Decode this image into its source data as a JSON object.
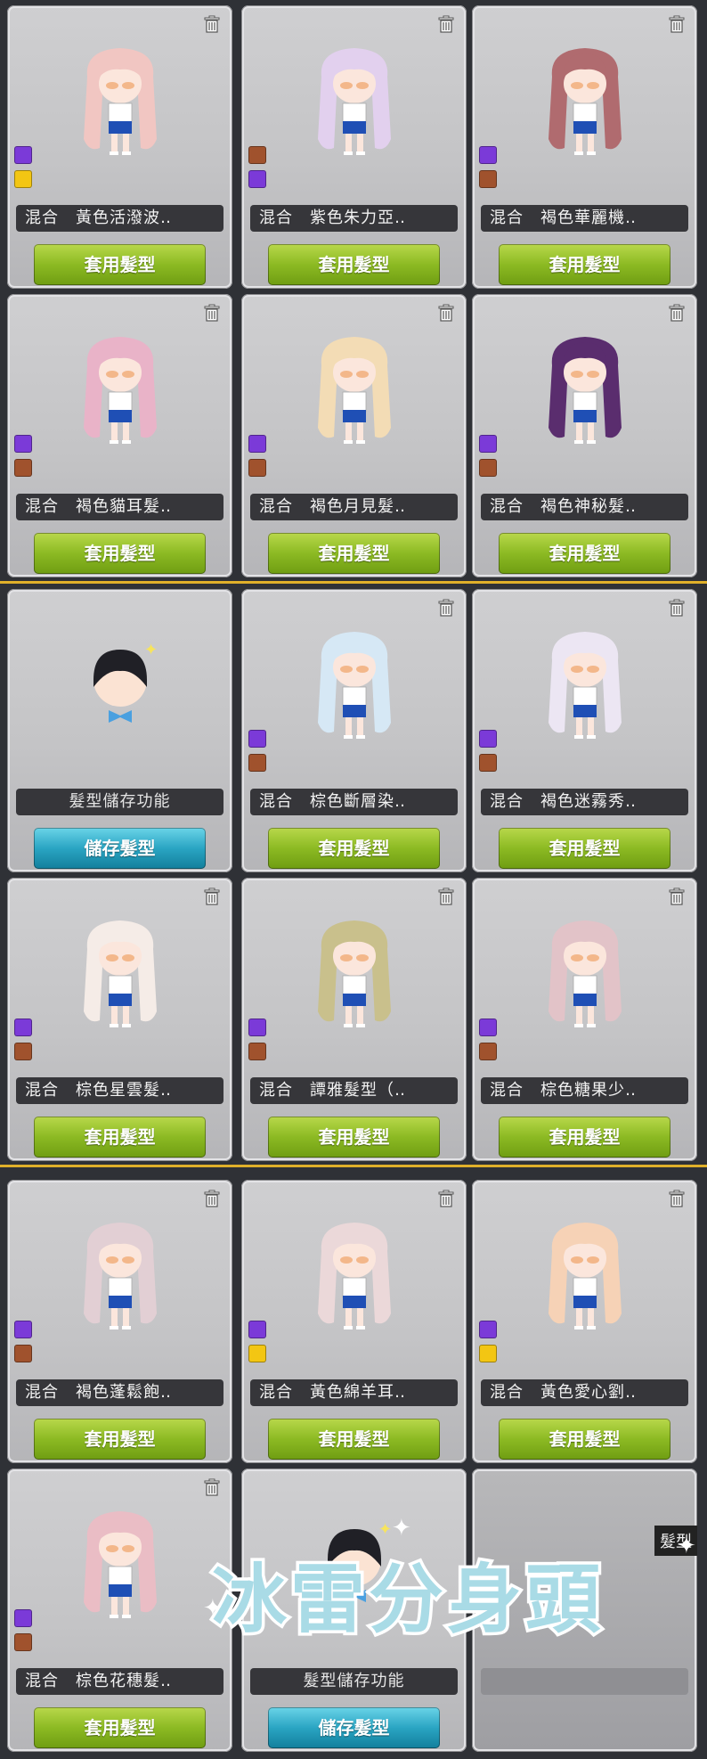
{
  "apply_label": "套用髮型",
  "save_label": "儲存髮型",
  "storage_label": "髮型儲存功能",
  "watermark": "冰雷分身頭",
  "side_tag": "髮型",
  "colors": {
    "purple": "#7b3ad8",
    "brown": "#a0522d",
    "yellow": "#f3c613"
  },
  "cards": [
    {
      "name": "混合　黃色活潑波‥",
      "swatches": [
        "purple",
        "yellow"
      ],
      "hair": "#f1c6c2",
      "type": "hair"
    },
    {
      "name": "混合　紫色朱力亞‥",
      "swatches": [
        "brown",
        "purple"
      ],
      "hair": "#e2d0ee",
      "type": "hair"
    },
    {
      "name": "混合　褐色華麗機‥",
      "swatches": [
        "purple",
        "brown"
      ],
      "hair": "#b06b6f",
      "type": "hair"
    },
    {
      "name": "混合　褐色貓耳髮‥",
      "swatches": [
        "purple",
        "brown"
      ],
      "hair": "#e9b3c8",
      "type": "hair"
    },
    {
      "name": "混合　褐色月見髮‥",
      "swatches": [
        "purple",
        "brown"
      ],
      "hair": "#f3dcb5",
      "type": "hair"
    },
    {
      "name": "混合　褐色神秘髮‥",
      "swatches": [
        "purple",
        "brown"
      ],
      "hair": "#5a2d6e",
      "type": "hair"
    },
    {
      "name": "髮型儲存功能",
      "swatches": [],
      "hair": "#202026",
      "type": "storage"
    },
    {
      "name": "混合　棕色斷層染‥",
      "swatches": [
        "purple",
        "brown"
      ],
      "hair": "#d6e8f5",
      "type": "hair"
    },
    {
      "name": "混合　褐色迷霧秀‥",
      "swatches": [
        "purple",
        "brown"
      ],
      "hair": "#ece6f3",
      "type": "hair"
    },
    {
      "name": "混合　棕色星雲髮‥",
      "swatches": [
        "purple",
        "brown"
      ],
      "hair": "#f5ece7",
      "type": "hair"
    },
    {
      "name": "混合　譚雅髮型（‥",
      "swatches": [
        "purple",
        "brown"
      ],
      "hair": "#c9c08c",
      "type": "hair"
    },
    {
      "name": "混合　棕色糖果少‥",
      "swatches": [
        "purple",
        "brown"
      ],
      "hair": "#e2c3c8",
      "type": "hair"
    },
    {
      "name": "混合　褐色蓬鬆飽‥",
      "swatches": [
        "purple",
        "brown"
      ],
      "hair": "#e2cfd4",
      "type": "hair"
    },
    {
      "name": "混合　黃色綿羊耳‥",
      "swatches": [
        "purple",
        "yellow"
      ],
      "hair": "#ebd8d9",
      "type": "hair"
    },
    {
      "name": "混合　黃色愛心劉‥",
      "swatches": [
        "purple",
        "yellow"
      ],
      "hair": "#f6d2b6",
      "type": "hair"
    },
    {
      "name": "混合　棕色花穗髮‥",
      "swatches": [
        "purple",
        "brown"
      ],
      "hair": "#eabdc5",
      "type": "hair"
    },
    {
      "name": "髮型儲存功能",
      "swatches": [],
      "hair": "#202026",
      "type": "storage"
    },
    {
      "name": "",
      "swatches": [],
      "hair": "#999",
      "type": "empty"
    }
  ]
}
